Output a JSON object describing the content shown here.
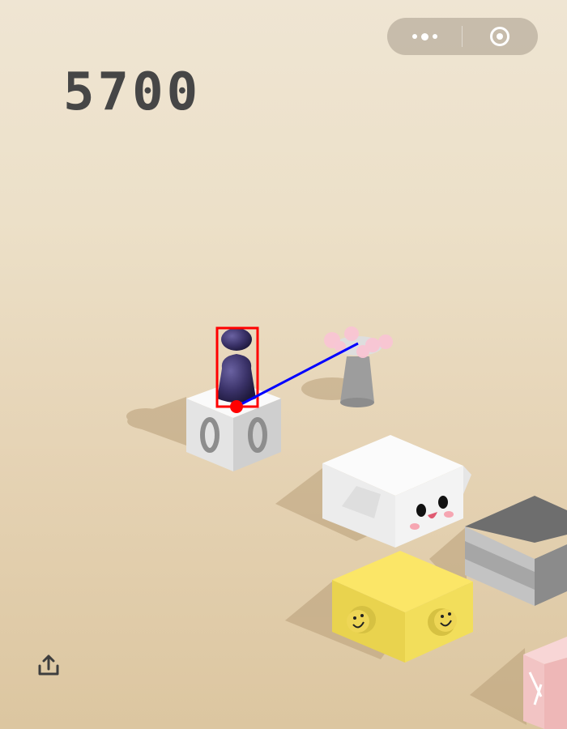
{
  "score": "5700",
  "capsule": {
    "more_icon": "more-dots-icon",
    "close_icon": "target-circle-icon"
  },
  "share_icon": "share-upload-icon",
  "colors": {
    "score": "#464646",
    "player": "#3a3268",
    "target_box": "#ff0000",
    "aim_line": "#0000ff",
    "yellow_box": "#f6e363",
    "pink_box": "#f2c9c9"
  }
}
